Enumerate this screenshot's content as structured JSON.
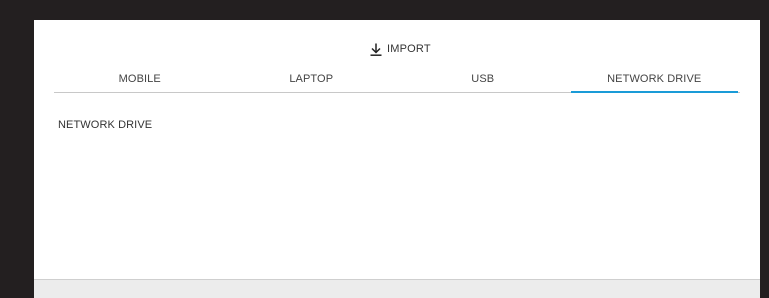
{
  "dialog": {
    "import_label": "IMPORT",
    "import_icon": "download-arrow-icon"
  },
  "tabs": [
    {
      "label": "MOBILE",
      "active": false
    },
    {
      "label": "LAPTOP",
      "active": false
    },
    {
      "label": "USB",
      "active": false
    },
    {
      "label": "NETWORK DRIVE",
      "active": true
    }
  ],
  "content": {
    "title": "NETWORK DRIVE"
  },
  "colors": {
    "backdrop": "#231f20",
    "panel": "#ffffff",
    "active_tab_indicator": "#1a9bd7",
    "footer": "#ececec",
    "text": "#333333"
  }
}
